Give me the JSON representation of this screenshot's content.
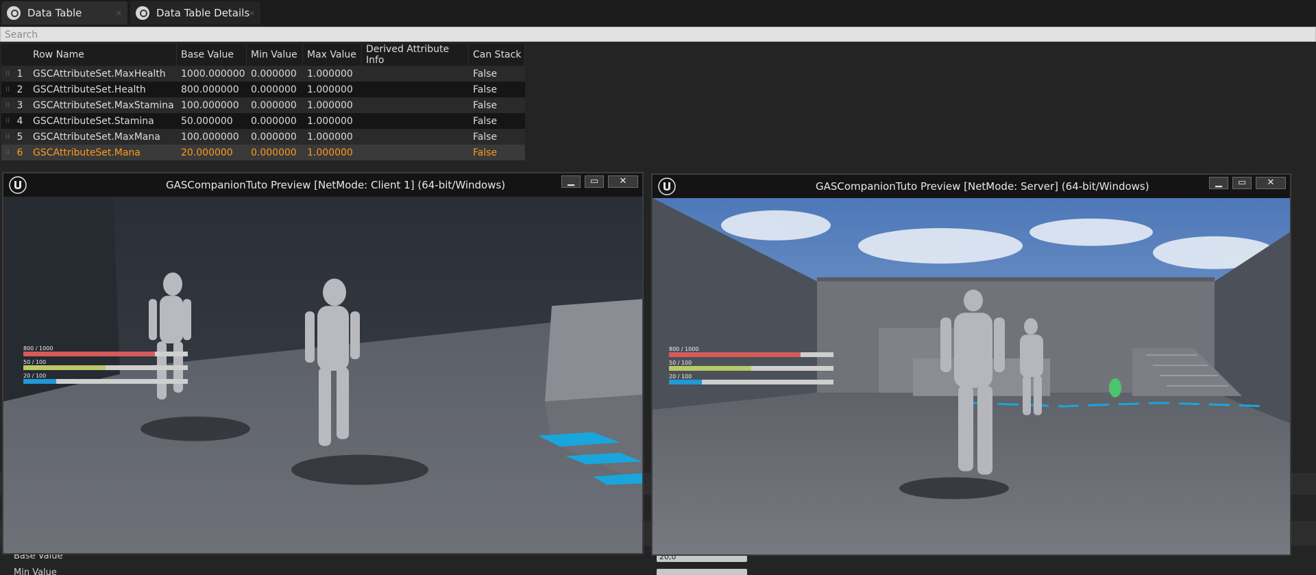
{
  "tabs": [
    {
      "label": "Data Table",
      "icon": "data-table-icon"
    },
    {
      "label": "Data Table Details",
      "icon": "data-table-details-icon"
    }
  ],
  "search": {
    "placeholder": "Search"
  },
  "table": {
    "columns": [
      "Row Name",
      "Base Value",
      "Min Value",
      "Max Value",
      "Derived Attribute Info",
      "Can Stack"
    ],
    "rows": [
      {
        "num": "1",
        "name": "GSCAttributeSet.MaxHealth",
        "base": "1000.000000",
        "min": "0.000000",
        "max": "1.000000",
        "derived": "",
        "stack": "False"
      },
      {
        "num": "2",
        "name": "GSCAttributeSet.Health",
        "base": "800.000000",
        "min": "0.000000",
        "max": "1.000000",
        "derived": "",
        "stack": "False"
      },
      {
        "num": "3",
        "name": "GSCAttributeSet.MaxStamina",
        "base": "100.000000",
        "min": "0.000000",
        "max": "1.000000",
        "derived": "",
        "stack": "False"
      },
      {
        "num": "4",
        "name": "GSCAttributeSet.Stamina",
        "base": "50.000000",
        "min": "0.000000",
        "max": "1.000000",
        "derived": "",
        "stack": "False"
      },
      {
        "num": "5",
        "name": "GSCAttributeSet.MaxMana",
        "base": "100.000000",
        "min": "0.000000",
        "max": "1.000000",
        "derived": "",
        "stack": "False"
      },
      {
        "num": "6",
        "name": "GSCAttributeSet.Mana",
        "base": "20.000000",
        "min": "0.000000",
        "max": "1.000000",
        "derived": "",
        "stack": "False"
      }
    ],
    "selected_row": 6,
    "selected_color": "#ff9a1e"
  },
  "windows": {
    "client": {
      "title": "GASCompanionTuto Preview [NetMode: Client 1]  (64-bit/Windows)",
      "hud": [
        {
          "label": "800 / 1000",
          "fill": 0.8,
          "color": "#d65a5a"
        },
        {
          "label": "50 / 100",
          "fill": 0.5,
          "color": "#b8c96a"
        },
        {
          "label": "20 / 100",
          "fill": 0.2,
          "color": "#1e9ad6"
        }
      ]
    },
    "server": {
      "title": "GASCompanionTuto Preview [NetMode: Server]  (64-bit/Windows)",
      "hud": [
        {
          "label": "800 / 1000",
          "fill": 0.8,
          "color": "#d65a5a"
        },
        {
          "label": "50 / 100",
          "fill": 0.5,
          "color": "#b8c96a"
        },
        {
          "label": "20 / 100",
          "fill": 0.2,
          "color": "#1e9ad6"
        }
      ]
    },
    "buttons": {
      "minimize": "▁",
      "maximize": "▭",
      "close": "✕"
    }
  },
  "details_panel": {
    "base_value_label": "Base Value",
    "partial_label": "Min Value",
    "base_value_input": "20,0"
  }
}
